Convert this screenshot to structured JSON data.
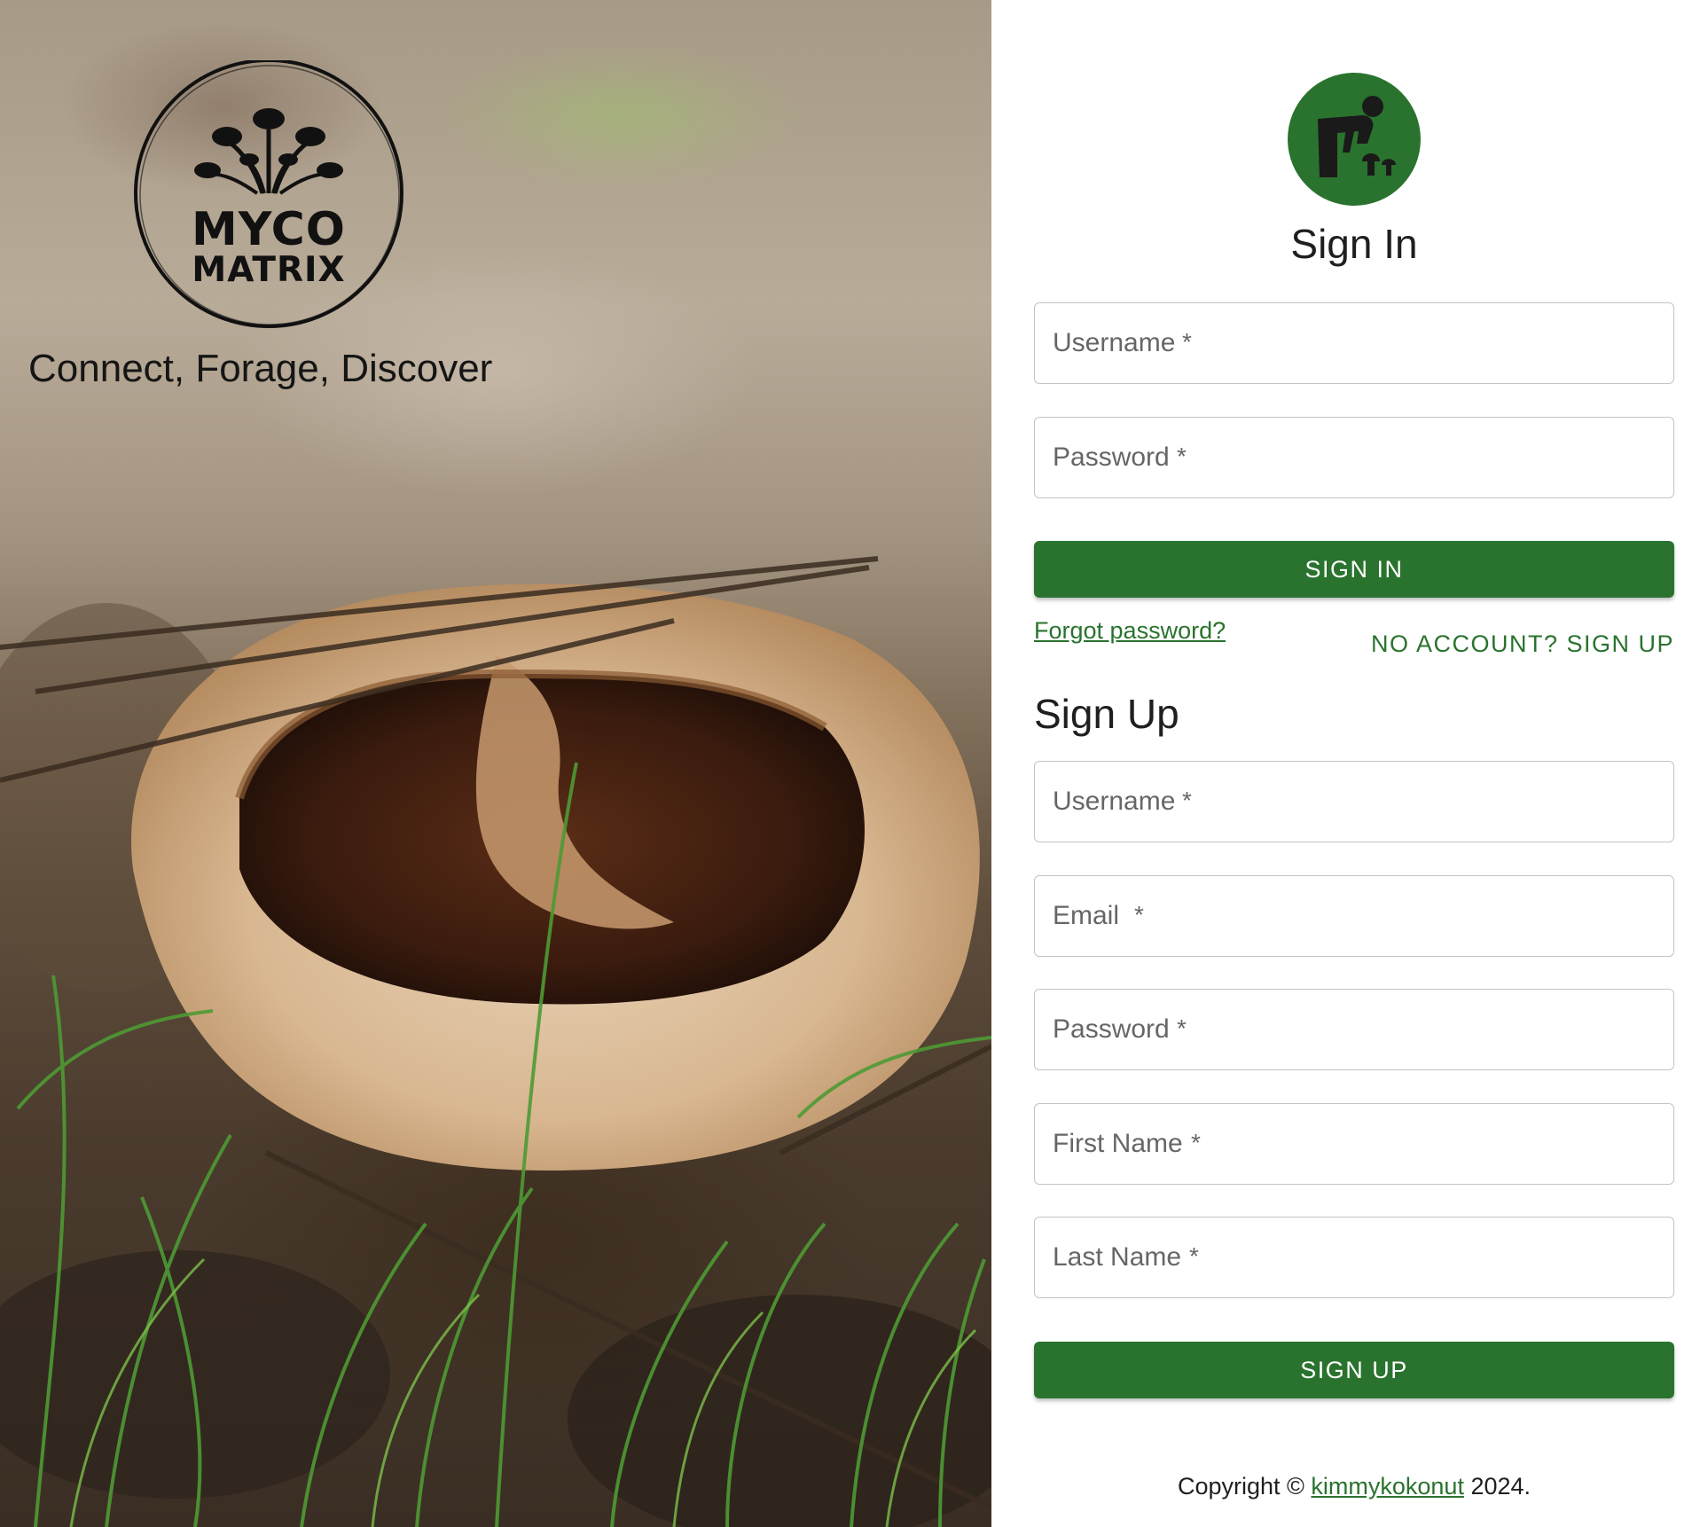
{
  "brand": {
    "logo_line1": "MYCO",
    "logo_line2": "MATRIX",
    "tagline": "Connect, Forage, Discover"
  },
  "signin": {
    "title": "Sign In",
    "username_placeholder": "Username",
    "password_placeholder": "Password",
    "required_mark": "*",
    "submit_label": "SIGN IN",
    "forgot_label": "Forgot password?",
    "signup_link_label": "NO ACCOUNT? SIGN UP"
  },
  "signup": {
    "title": "Sign Up",
    "username_placeholder": "Username",
    "email_placeholder": "Email",
    "password_placeholder": "Password",
    "firstname_placeholder": "First Name",
    "lastname_placeholder": "Last Name",
    "required_mark": "*",
    "submit_label": "SIGN UP"
  },
  "footer": {
    "prefix": "Copyright © ",
    "author": "kimmykokonut",
    "suffix": " 2024."
  },
  "colors": {
    "accent": "#2a732e",
    "field_border": "#c4c4c4",
    "text": "#1f1f1f"
  },
  "icons": {
    "avatar": "forager-mushroom-icon",
    "logo": "mushroom-cluster-icon"
  }
}
